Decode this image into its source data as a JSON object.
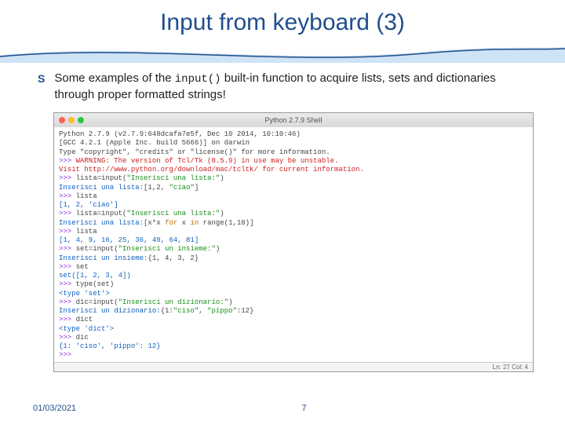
{
  "title": "Input from keyboard (3)",
  "bullet": {
    "marker": "S",
    "text_pre": "Some examples of the ",
    "code": "input()",
    "text_post": " built-in function to acquire lists, sets and dictionaries through proper formatted strings!"
  },
  "shell": {
    "window_title": "Python 2.7.9 Shell",
    "status": "Ln: 27 Col: 4",
    "lines": [
      {
        "segs": [
          {
            "t": "Python 2.7.9 (v2.7.9:648dcafa7e5f, Dec 10 2014, 10:10:46)"
          }
        ]
      },
      {
        "segs": [
          {
            "t": "[GCC 4.2.1 (Apple Inc. build 5666)] on darwin"
          }
        ]
      },
      {
        "segs": [
          {
            "t": "Type \"copyright\", \"credits\" or \"license()\" for more information."
          }
        ]
      },
      {
        "segs": [
          {
            "t": ">>> ",
            "c": "c-purple"
          },
          {
            "t": "WARNING: The version of Tcl/Tk (8.5.9) in use may be unstable.",
            "c": "c-red"
          }
        ]
      },
      {
        "segs": [
          {
            "t": "Visit http://www.python.org/download/mac/tcltk/ for current information.",
            "c": "c-red"
          }
        ]
      },
      {
        "segs": [
          {
            "t": ""
          }
        ]
      },
      {
        "segs": [
          {
            "t": ">>> ",
            "c": "c-purple"
          },
          {
            "t": "lista=input("
          },
          {
            "t": "\"Inserisci una lista:\"",
            "c": "c-green"
          },
          {
            "t": ")"
          }
        ]
      },
      {
        "segs": [
          {
            "t": "Inserisci una lista:",
            "c": "c-blue"
          },
          {
            "t": "[1,2, "
          },
          {
            "t": "\"ciao\"",
            "c": "c-green"
          },
          {
            "t": "]"
          }
        ]
      },
      {
        "segs": [
          {
            "t": ">>> ",
            "c": "c-purple"
          },
          {
            "t": "lista"
          }
        ]
      },
      {
        "segs": [
          {
            "t": "[1, 2, 'ciao']",
            "c": "c-blue"
          }
        ]
      },
      {
        "segs": [
          {
            "t": ">>> ",
            "c": "c-purple"
          },
          {
            "t": "lista=input("
          },
          {
            "t": "\"Inserisci una lista:\"",
            "c": "c-green"
          },
          {
            "t": ")"
          }
        ]
      },
      {
        "segs": [
          {
            "t": "Inserisci una lista:",
            "c": "c-blue"
          },
          {
            "t": "[x*x "
          },
          {
            "t": "for",
            "c": "c-orange"
          },
          {
            "t": " x "
          },
          {
            "t": "in",
            "c": "c-orange"
          },
          {
            "t": " range(1,10)]"
          }
        ]
      },
      {
        "segs": [
          {
            "t": ">>> ",
            "c": "c-purple"
          },
          {
            "t": "lista"
          }
        ]
      },
      {
        "segs": [
          {
            "t": "[1, 4, 9, 16, 25, 36, 49, 64, 81]",
            "c": "c-blue"
          }
        ]
      },
      {
        "segs": [
          {
            "t": ">>> ",
            "c": "c-purple"
          },
          {
            "t": "set=input("
          },
          {
            "t": "\"Inserisci un insieme:\"",
            "c": "c-green"
          },
          {
            "t": ")"
          }
        ]
      },
      {
        "segs": [
          {
            "t": "Inserisci un insieme:",
            "c": "c-blue"
          },
          {
            "t": "{1, 4, 3, 2}"
          }
        ]
      },
      {
        "segs": [
          {
            "t": ">>> ",
            "c": "c-purple"
          },
          {
            "t": "set"
          }
        ]
      },
      {
        "segs": [
          {
            "t": "set([1, 2, 3, 4])",
            "c": "c-blue"
          }
        ]
      },
      {
        "segs": [
          {
            "t": ">>> ",
            "c": "c-purple"
          },
          {
            "t": "type(set)"
          }
        ]
      },
      {
        "segs": [
          {
            "t": "<type 'set'>",
            "c": "c-blue"
          }
        ]
      },
      {
        "segs": [
          {
            "t": ">>> ",
            "c": "c-purple"
          },
          {
            "t": "dic=input("
          },
          {
            "t": "\"Inserisci un dizionario:\"",
            "c": "c-green"
          },
          {
            "t": ")"
          }
        ]
      },
      {
        "segs": [
          {
            "t": "Inserisci un dizionario:",
            "c": "c-blue"
          },
          {
            "t": "{1:"
          },
          {
            "t": "\"ciso\"",
            "c": "c-green"
          },
          {
            "t": ", "
          },
          {
            "t": "\"pippo\"",
            "c": "c-green"
          },
          {
            "t": ":12}"
          }
        ]
      },
      {
        "segs": [
          {
            "t": ">>> ",
            "c": "c-purple"
          },
          {
            "t": "dict"
          }
        ]
      },
      {
        "segs": [
          {
            "t": "<type 'dict'>",
            "c": "c-blue"
          }
        ]
      },
      {
        "segs": [
          {
            "t": ">>> ",
            "c": "c-purple"
          },
          {
            "t": "dic"
          }
        ]
      },
      {
        "segs": [
          {
            "t": "{1: 'ciso', 'pippo': 12}",
            "c": "c-blue"
          }
        ]
      },
      {
        "segs": [
          {
            "t": ">>> ",
            "c": "c-purple"
          }
        ]
      }
    ]
  },
  "footer": {
    "date": "01/03/2021",
    "page": "7"
  }
}
